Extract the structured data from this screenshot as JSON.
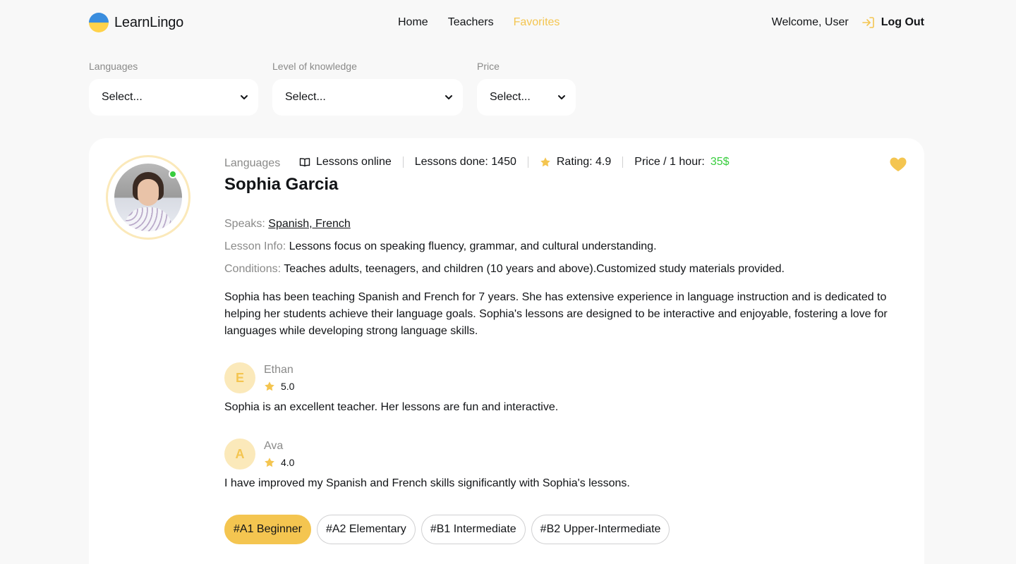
{
  "header": {
    "logo_text": "LearnLingo",
    "nav": [
      {
        "label": "Home",
        "active": false
      },
      {
        "label": "Teachers",
        "active": false
      },
      {
        "label": "Favorites",
        "active": true
      }
    ],
    "welcome": "Welcome, User",
    "logout_label": "Log Out"
  },
  "filters": [
    {
      "label": "Languages",
      "value": "Select..."
    },
    {
      "label": "Level of knowledge",
      "value": "Select..."
    },
    {
      "label": "Price",
      "value": "Select..."
    }
  ],
  "teacher": {
    "languages_label": "Languages",
    "name": "Sophia Garcia",
    "stats": {
      "lessons_online": "Lessons online",
      "lessons_done": "Lessons done: 1450",
      "rating": "Rating: 4.9",
      "price_label": "Price / 1 hour: ",
      "price_value": "35$"
    },
    "speaks_key": "Speaks: ",
    "speaks_value": "Spanish, French",
    "lesson_info_key": "Lesson Info: ",
    "lesson_info_value": "Lessons focus on speaking fluency, grammar, and cultural understanding.",
    "conditions_key": "Conditions: ",
    "conditions_value": "Teaches adults, teenagers, and children (10 years and above).Customized study materials provided.",
    "bio": "Sophia has been teaching Spanish and French for 7 years. She has extensive experience in language instruction and is dedicated to helping her students achieve their language goals. Sophia's lessons are designed to be interactive and enjoyable, fostering a love for languages while developing strong language skills.",
    "reviews": [
      {
        "initial": "E",
        "name": "Ethan",
        "rating": "5.0",
        "text": "Sophia is an excellent teacher. Her lessons are fun and interactive."
      },
      {
        "initial": "A",
        "name": "Ava",
        "rating": "4.0",
        "text": "I have improved my Spanish and French skills significantly with Sophia's lessons."
      }
    ],
    "levels": [
      {
        "label": "#A1 Beginner",
        "active": true
      },
      {
        "label": "#A2 Elementary",
        "active": false
      },
      {
        "label": "#B1 Intermediate",
        "active": false
      },
      {
        "label": "#B2 Upper-Intermediate",
        "active": false
      }
    ]
  },
  "colors": {
    "accent": "#f4c550",
    "accent_light": "#fbe9ba",
    "price_green": "#38cd3e",
    "muted": "#8a8a89",
    "background": "#f8f8f8"
  },
  "icons": {
    "logo": "ukraine-flag-circle-icon",
    "logout": "log-in-arrow-icon",
    "dropdown": "chevron-down-icon",
    "lessons": "open-book-icon",
    "rating": "star-icon",
    "favorite": "heart-icon"
  }
}
